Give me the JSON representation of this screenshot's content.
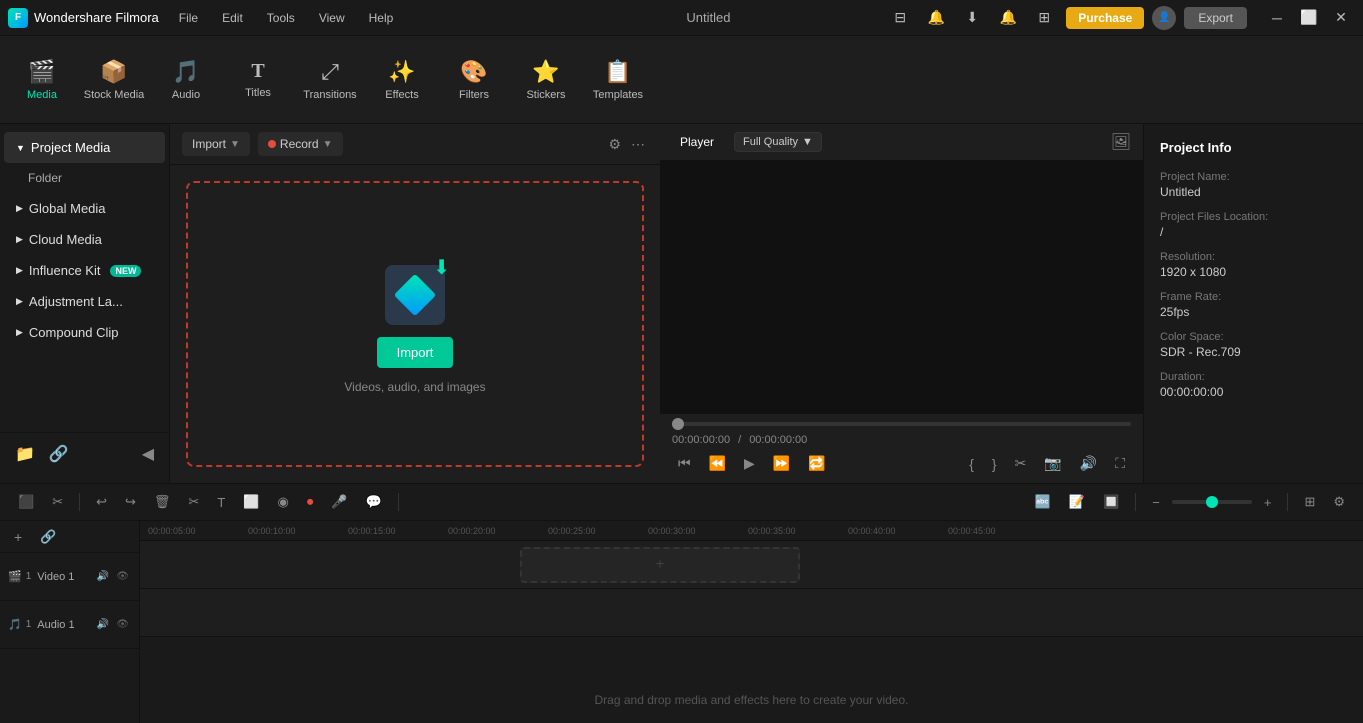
{
  "app": {
    "name": "Wondershare Filmora",
    "window_title": "Untitled"
  },
  "titlebar": {
    "brand": "Wondershare Filmora",
    "menu_items": [
      "File",
      "Edit",
      "Tools",
      "View",
      "Help"
    ],
    "purchase_label": "Purchase",
    "export_label": "Export"
  },
  "toolbar": {
    "items": [
      {
        "id": "media",
        "label": "Media",
        "icon": "🎬",
        "active": true
      },
      {
        "id": "stock-media",
        "label": "Stock Media",
        "icon": "📦"
      },
      {
        "id": "audio",
        "label": "Audio",
        "icon": "🎵"
      },
      {
        "id": "titles",
        "label": "Titles",
        "icon": "T"
      },
      {
        "id": "transitions",
        "label": "Transitions",
        "icon": "⤢"
      },
      {
        "id": "effects",
        "label": "Effects",
        "icon": "✨"
      },
      {
        "id": "filters",
        "label": "Filters",
        "icon": "🎨"
      },
      {
        "id": "stickers",
        "label": "Stickers",
        "icon": "⭐"
      },
      {
        "id": "templates",
        "label": "Templates",
        "icon": "📋"
      }
    ]
  },
  "sidebar": {
    "title": "Project Media",
    "sections": [
      {
        "id": "project-media",
        "label": "Project Media",
        "active": true,
        "expanded": true
      },
      {
        "id": "folder",
        "label": "Folder",
        "indent": true
      },
      {
        "id": "global-media",
        "label": "Global Media",
        "expanded": false
      },
      {
        "id": "cloud-media",
        "label": "Cloud Media",
        "expanded": false
      },
      {
        "id": "influence-kit",
        "label": "Influence Kit",
        "badge": "NEW",
        "expanded": false
      },
      {
        "id": "adjustment-la",
        "label": "Adjustment La...",
        "expanded": false
      },
      {
        "id": "compound-clip",
        "label": "Compound Clip",
        "expanded": false
      }
    ],
    "bottom_buttons": [
      "add-folder",
      "add-item",
      "collapse"
    ]
  },
  "media_toolbar": {
    "import_label": "Import",
    "record_label": "Record"
  },
  "drop_zone": {
    "import_btn_label": "Import",
    "subtitle": "Videos, audio, and images"
  },
  "player": {
    "tab_player": "Player",
    "quality": "Full Quality",
    "time_current": "00:00:00:00",
    "time_total": "00:00:00:00"
  },
  "player_controls": {
    "buttons": [
      "rewind",
      "step-back",
      "play",
      "step-forward",
      "loop",
      "mark-in",
      "mark-out",
      "split",
      "snapshot",
      "audio",
      "fullscreen"
    ]
  },
  "project_info": {
    "title": "Project Info",
    "name_label": "Project Name:",
    "name_value": "Untitled",
    "files_label": "Project Files Location:",
    "files_value": "/",
    "resolution_label": "Resolution:",
    "resolution_value": "1920 x 1080",
    "framerate_label": "Frame Rate:",
    "framerate_value": "25fps",
    "colorspace_label": "Color Space:",
    "colorspace_value": "SDR - Rec.709",
    "duration_label": "Duration:",
    "duration_value": "00:00:00:00"
  },
  "timeline": {
    "ruler_marks": [
      "00:00:05:00",
      "00:00:10:00",
      "00:00:15:00",
      "00:00:20:00",
      "00:00:25:00",
      "00:00:30:00",
      "00:00:35:00",
      "00:00:40:00",
      "00:00:45:00"
    ],
    "tracks": [
      {
        "id": "video-1",
        "label": "Video 1",
        "type": "video"
      },
      {
        "id": "audio-1",
        "label": "Audio 1",
        "type": "audio"
      }
    ],
    "drop_text": "Drag and drop media and effects here to create your video."
  },
  "colors": {
    "accent": "#00e5b4",
    "danger": "#c0392b",
    "purchase": "#e8aa14",
    "bg_dark": "#1a1a1a",
    "bg_main": "#1e1e1e"
  }
}
